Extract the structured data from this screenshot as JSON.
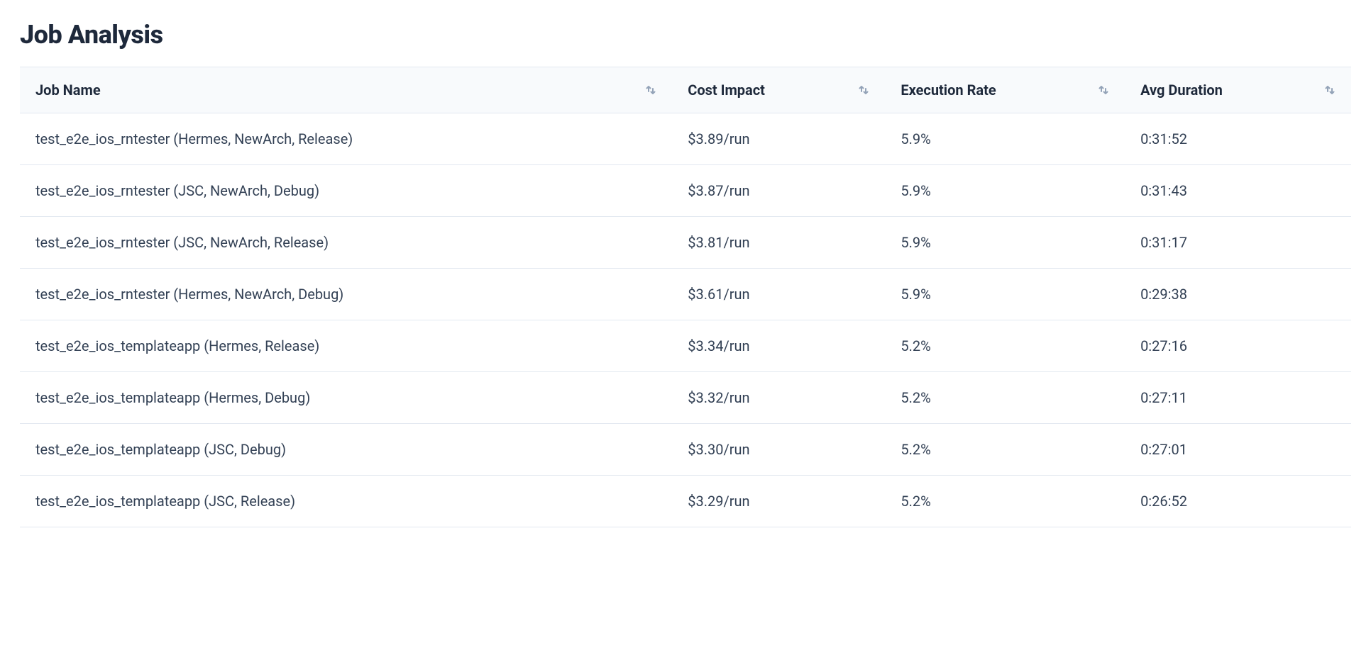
{
  "title": "Job Analysis",
  "columns": [
    {
      "label": "Job Name"
    },
    {
      "label": "Cost Impact"
    },
    {
      "label": "Execution Rate"
    },
    {
      "label": "Avg Duration"
    }
  ],
  "rows": [
    {
      "name": "test_e2e_ios_rntester (Hermes, NewArch, Release)",
      "cost": "$3.89/run",
      "exec": "5.9%",
      "dur": "0:31:52"
    },
    {
      "name": "test_e2e_ios_rntester (JSC, NewArch, Debug)",
      "cost": "$3.87/run",
      "exec": "5.9%",
      "dur": "0:31:43"
    },
    {
      "name": "test_e2e_ios_rntester (JSC, NewArch, Release)",
      "cost": "$3.81/run",
      "exec": "5.9%",
      "dur": "0:31:17"
    },
    {
      "name": "test_e2e_ios_rntester (Hermes, NewArch, Debug)",
      "cost": "$3.61/run",
      "exec": "5.9%",
      "dur": "0:29:38"
    },
    {
      "name": "test_e2e_ios_templateapp (Hermes, Release)",
      "cost": "$3.34/run",
      "exec": "5.2%",
      "dur": "0:27:16"
    },
    {
      "name": "test_e2e_ios_templateapp (Hermes, Debug)",
      "cost": "$3.32/run",
      "exec": "5.2%",
      "dur": "0:27:11"
    },
    {
      "name": "test_e2e_ios_templateapp (JSC, Debug)",
      "cost": "$3.30/run",
      "exec": "5.2%",
      "dur": "0:27:01"
    },
    {
      "name": "test_e2e_ios_templateapp (JSC, Release)",
      "cost": "$3.29/run",
      "exec": "5.2%",
      "dur": "0:26:52"
    }
  ]
}
